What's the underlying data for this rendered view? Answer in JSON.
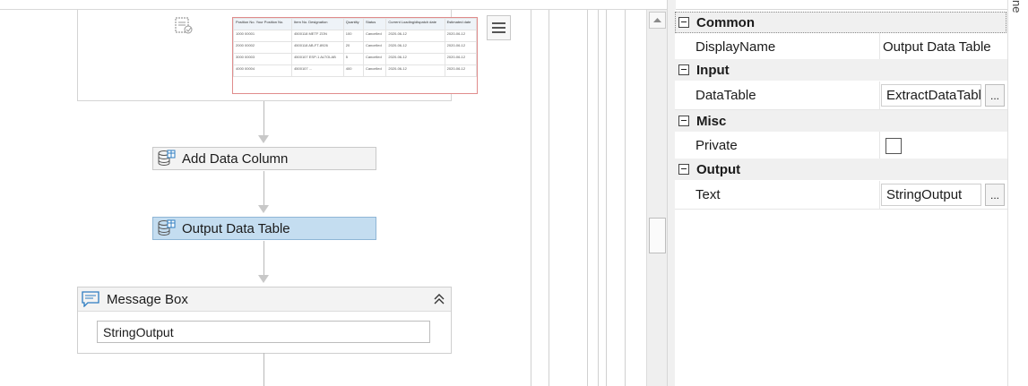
{
  "designer": {
    "extract_preview": {
      "headers": [
        "Position No. Your Position No.",
        "Item No. Designation",
        "Quantity",
        "Status",
        "Current Loading/dispatch date",
        "Estimated date"
      ],
      "rows": [
        [
          "1000 00001",
          "4500118 METF ZON",
          "100",
          "Cancelled",
          "2020-06-12",
          "2020-06-12"
        ],
        [
          "2000 00002",
          "4500118 AB-FT-8926",
          "20",
          "Cancelled",
          "2020-06-12",
          "2020-06-12"
        ],
        [
          "3000 00003",
          "4500107 ESP-1 ALTOLAB",
          "5",
          "Cancelled",
          "2020-06-12",
          "2020-06-12"
        ],
        [
          "4000 00004",
          "4500107 ...",
          "400",
          "Cancelled",
          "2020-06-12",
          "2020-06-12"
        ]
      ]
    },
    "activities": {
      "add_data_column": "Add Data Column",
      "output_data_table": "Output Data Table"
    },
    "message_box": {
      "title": "Message Box",
      "text_value": "StringOutput"
    }
  },
  "properties": {
    "categories": {
      "common": "Common",
      "input": "Input",
      "misc": "Misc",
      "output": "Output"
    },
    "rows": {
      "display_name": {
        "label": "DisplayName",
        "value": "Output Data Table"
      },
      "data_table": {
        "label": "DataTable",
        "value": "ExtractDataTabl"
      },
      "private": {
        "label": "Private"
      },
      "text": {
        "label": "Text",
        "value": "StringOutput"
      }
    },
    "ellipsis_label": "..."
  },
  "right_edge_text": "ne"
}
